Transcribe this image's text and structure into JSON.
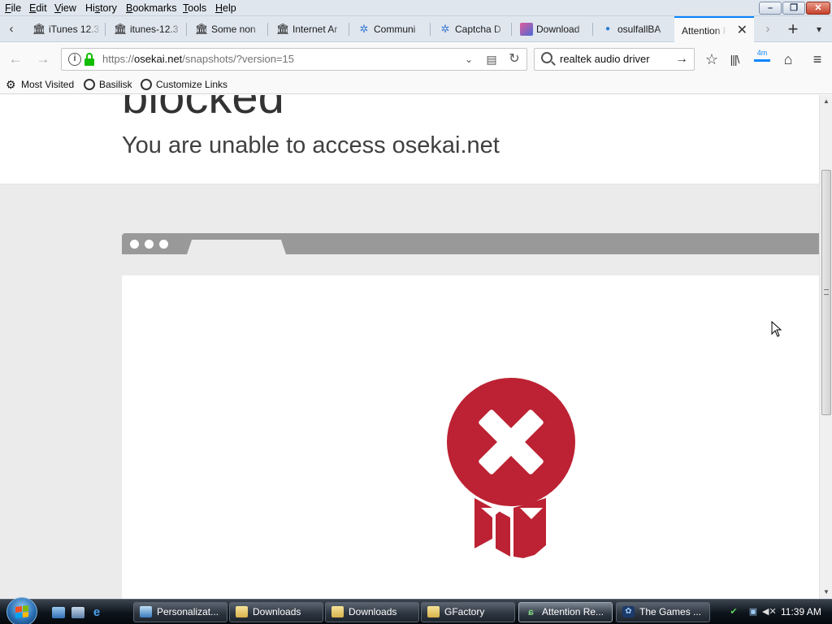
{
  "menu": {
    "items": [
      {
        "accel": "F",
        "rest": "ile"
      },
      {
        "accel": "E",
        "rest": "dit"
      },
      {
        "accel": "V",
        "rest": "iew"
      },
      {
        "accel": "",
        "pre": "Hi",
        "accel2": "s",
        "rest": "tory"
      },
      {
        "accel": "B",
        "rest": "ookmarks"
      },
      {
        "accel": "T",
        "rest": "ools"
      },
      {
        "accel": "H",
        "rest": "elp"
      }
    ]
  },
  "tabs": [
    {
      "label": "iTunes 12.3",
      "icon": "archive-icon"
    },
    {
      "label": "itunes-12.3",
      "icon": "archive-icon"
    },
    {
      "label": "Some non",
      "icon": "archive-icon"
    },
    {
      "label": "Internet Ar",
      "icon": "archive-icon"
    },
    {
      "label": "Communi",
      "icon": "puzzle-icon"
    },
    {
      "label": "Captcha D",
      "icon": "puzzle-icon"
    },
    {
      "label": "Download",
      "icon": "download-icon"
    },
    {
      "label": "osulfallBA",
      "icon": "dot-icon"
    }
  ],
  "active_tab": {
    "label": "Attention R"
  },
  "navbar": {
    "url_prefix": "https://",
    "url_host": "osekai.net",
    "url_path": "/snapshots/?version=15",
    "search_value": "realtek audio driver",
    "zoom_badge": "4m"
  },
  "bookmarks": [
    {
      "label": "Most Visited",
      "icon": "gear-icon"
    },
    {
      "label": "Basilisk",
      "icon": "globe-icon"
    },
    {
      "label": "Customize Links",
      "icon": "globe-icon"
    }
  ],
  "page": {
    "heading": "blocked",
    "subheading": "You are unable to access osekai.net"
  },
  "colors": {
    "accent": "#0a84ff",
    "badge_red": "#bc2233",
    "lock_green": "#12bc00"
  },
  "taskbar": {
    "buttons": [
      {
        "label": "Personalizat...",
        "icon": "monitor-icon"
      },
      {
        "label": "Downloads",
        "icon": "folder-icon"
      },
      {
        "label": "Downloads",
        "icon": "folder-icon"
      },
      {
        "label": "GFactory",
        "icon": "folder-icon"
      },
      {
        "label": "Attention Re...",
        "icon": "browser-icon"
      },
      {
        "label": "The Games ...",
        "icon": "game-icon"
      }
    ],
    "clock": "11:39 AM"
  }
}
